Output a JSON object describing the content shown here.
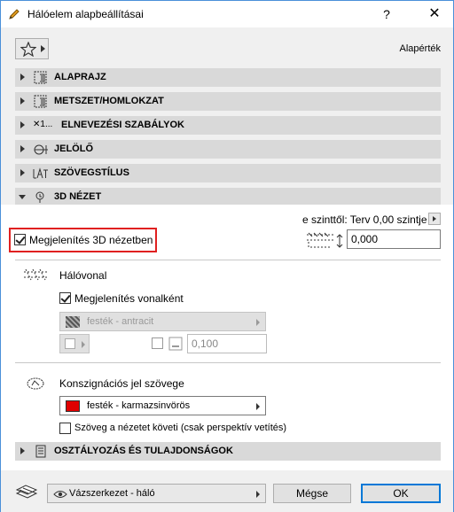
{
  "window": {
    "title": "Hálóelem alapbeállításai",
    "help": "?",
    "close": "✕"
  },
  "header": {
    "default_label": "Alapérték"
  },
  "panels": [
    {
      "label": "ALAPRAJZ"
    },
    {
      "label": "METSZET/HOMLOKZAT"
    },
    {
      "label": "ELNEVEZÉSI SZABÁLYOK",
      "icon_text": "✕1..."
    },
    {
      "label": "JELÖLŐ"
    },
    {
      "label": "SZÖVEGSTÍLUS"
    },
    {
      "label": "3D NÉZET"
    },
    {
      "label": "OSZTÁLYOZÁS ÉS TULAJDONSÁGOK"
    }
  ],
  "view3d": {
    "floor_note": "e szinttől: Terv 0,00 szintje",
    "show_in_3d": "Megjelenítés 3D nézetben",
    "show_in_3d_checked": true,
    "elevation_value": "0,000",
    "mesh_line_label": "Hálóvonal",
    "show_as_line": "Megjelenítés vonalként",
    "show_as_line_checked": true,
    "line_material": "festék - antracit",
    "line_value": "0,100",
    "consignation_label": "Konszignációs jel szövege",
    "text_material": "festék - karmazsinvörös",
    "text_material_color": "#e00000",
    "follow_view": "Szöveg a nézetet követi (csak perspektív vetítés)",
    "follow_view_checked": false
  },
  "footer": {
    "layer": "Vázszerkezet - háló",
    "cancel": "Mégse",
    "ok": "OK"
  }
}
